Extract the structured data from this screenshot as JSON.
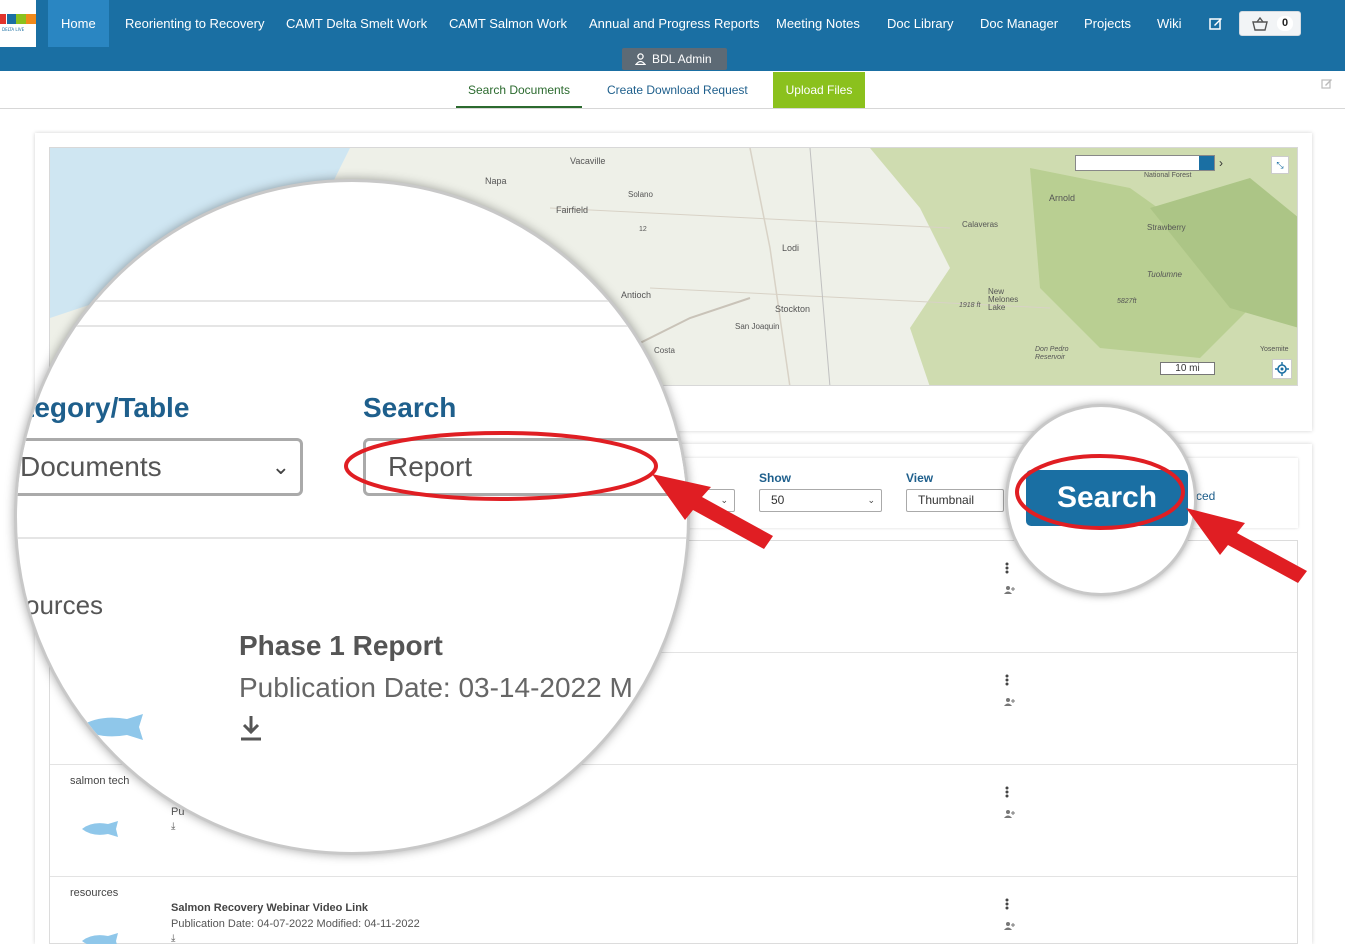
{
  "nav": {
    "items": [
      "Home",
      "Reorienting to Recovery",
      "CAMT Delta Smelt Work",
      "CAMT Salmon Work",
      "Annual and Progress Reports",
      "Meeting Notes",
      "Doc Library",
      "Doc Manager",
      "Projects",
      "Wiki"
    ],
    "cart_count": "0",
    "admin_label": "BDL Admin",
    "colors": {
      "bar": "#1a6fa3",
      "active": "#2a86c2"
    }
  },
  "tabs": {
    "search_documents": "Search Documents",
    "create_download": "Create Download Request",
    "upload_files": "Upload Files"
  },
  "map": {
    "labels": [
      "Vacaville",
      "Napa",
      "Solano",
      "Fairfield",
      "Lodi",
      "Antioch",
      "Stockton",
      "San Joaquin",
      "Costa",
      "Calaveras",
      "Arnold",
      "Strawberry",
      "Tuolumne",
      "National Forest",
      "New Melones Lake",
      "Don Pedro Reservoir",
      "Yosemite",
      "12",
      "1918 ft",
      "5827ft"
    ],
    "scale": "10 mi"
  },
  "controls": {
    "show_label": "Show",
    "show_value": "50",
    "view_label": "View",
    "view_value": "Thumbnail",
    "advanced_partial": "ced",
    "search_button": "Search"
  },
  "results": [
    {
      "category": "",
      "title": "",
      "meta": ""
    },
    {
      "category": "",
      "title": "",
      "meta": ""
    },
    {
      "category": "salmon tech",
      "title": "",
      "meta": "Pu"
    },
    {
      "category": "resources",
      "title": "Salmon Recovery Webinar Video Link",
      "meta": "Publication Date: 04-07-2022 Modified: 04-11-2022"
    }
  ],
  "magnifier": {
    "category_label": "tegory/Table",
    "category_value": "Documents",
    "search_label": "Search",
    "search_value": "Report",
    "row_category": "ources",
    "row_title": "Phase 1 Report",
    "row_meta": "Publication Date: 03-14-2022 M"
  },
  "annotations": {
    "highlight_color": "#e01e23"
  }
}
